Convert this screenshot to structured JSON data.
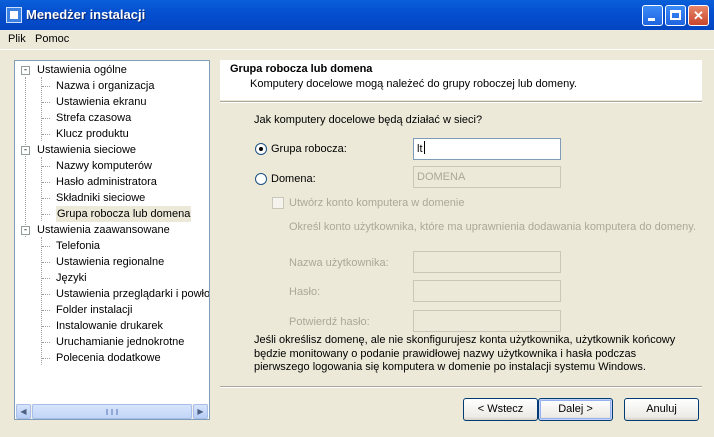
{
  "window": {
    "title": "Menedżer instalacji",
    "icon": "setup-manager-icon"
  },
  "menu": {
    "items": [
      {
        "label": "Plik"
      },
      {
        "label": "Pomoc"
      }
    ]
  },
  "tree": {
    "items": [
      {
        "label": "Ustawienia ogólne"
      },
      {
        "label": "Nazwa i organizacja"
      },
      {
        "label": "Ustawienia ekranu"
      },
      {
        "label": "Strefa czasowa"
      },
      {
        "label": "Klucz produktu"
      },
      {
        "label": "Ustawienia sieciowe"
      },
      {
        "label": "Nazwy komputerów"
      },
      {
        "label": "Hasło administratora"
      },
      {
        "label": "Składniki sieciowe"
      },
      {
        "label": "Grupa robocza lub domena"
      },
      {
        "label": "Ustawienia zaawansowane"
      },
      {
        "label": "Telefonia"
      },
      {
        "label": "Ustawienia regionalne"
      },
      {
        "label": "Języki"
      },
      {
        "label": "Ustawienia przeglądarki i powłoki"
      },
      {
        "label": "Folder instalacji"
      },
      {
        "label": "Instalowanie drukarek"
      },
      {
        "label": "Uruchamianie jednokrotne"
      },
      {
        "label": "Polecenia dodatkowe"
      }
    ],
    "expander": "-",
    "selected": "Grupa robocza lub domena"
  },
  "header": {
    "title": "Grupa robocza lub domena",
    "subtitle": "Komputery docelowe mogą należeć do grupy roboczej lub domeny."
  },
  "form": {
    "question": "Jak komputery docelowe będą działać w sieci?",
    "workgroup_label": "Grupa robocza:",
    "workgroup_value": "lt",
    "domain_label": "Domena:",
    "domain_value": "DOMENA",
    "create_account_label": "Utwórz konto komputera w domenie",
    "account_hint": "Określ konto użytkownika, które ma uprawnienia dodawania komputera do domeny.",
    "username_label": "Nazwa użytkownika:",
    "password_label": "Hasło:",
    "confirm_label": "Potwierdź hasło:",
    "note": "Jeśli określisz domenę, ale nie skonfigurujesz konta użytkownika, użytkownik końcowy będzie monitowany o podanie prawidłowej nazwy użytkownika i hasła podczas pierwszego logowania się komputera w domenie po instalacji systemu Windows."
  },
  "buttons": {
    "back": "< Wstecz",
    "next": "Dalej >",
    "cancel": "Anuluj"
  },
  "colors": {
    "titlebar": "#0550D0",
    "face": "#ECE9D8",
    "selection": "#ECE9D8"
  }
}
